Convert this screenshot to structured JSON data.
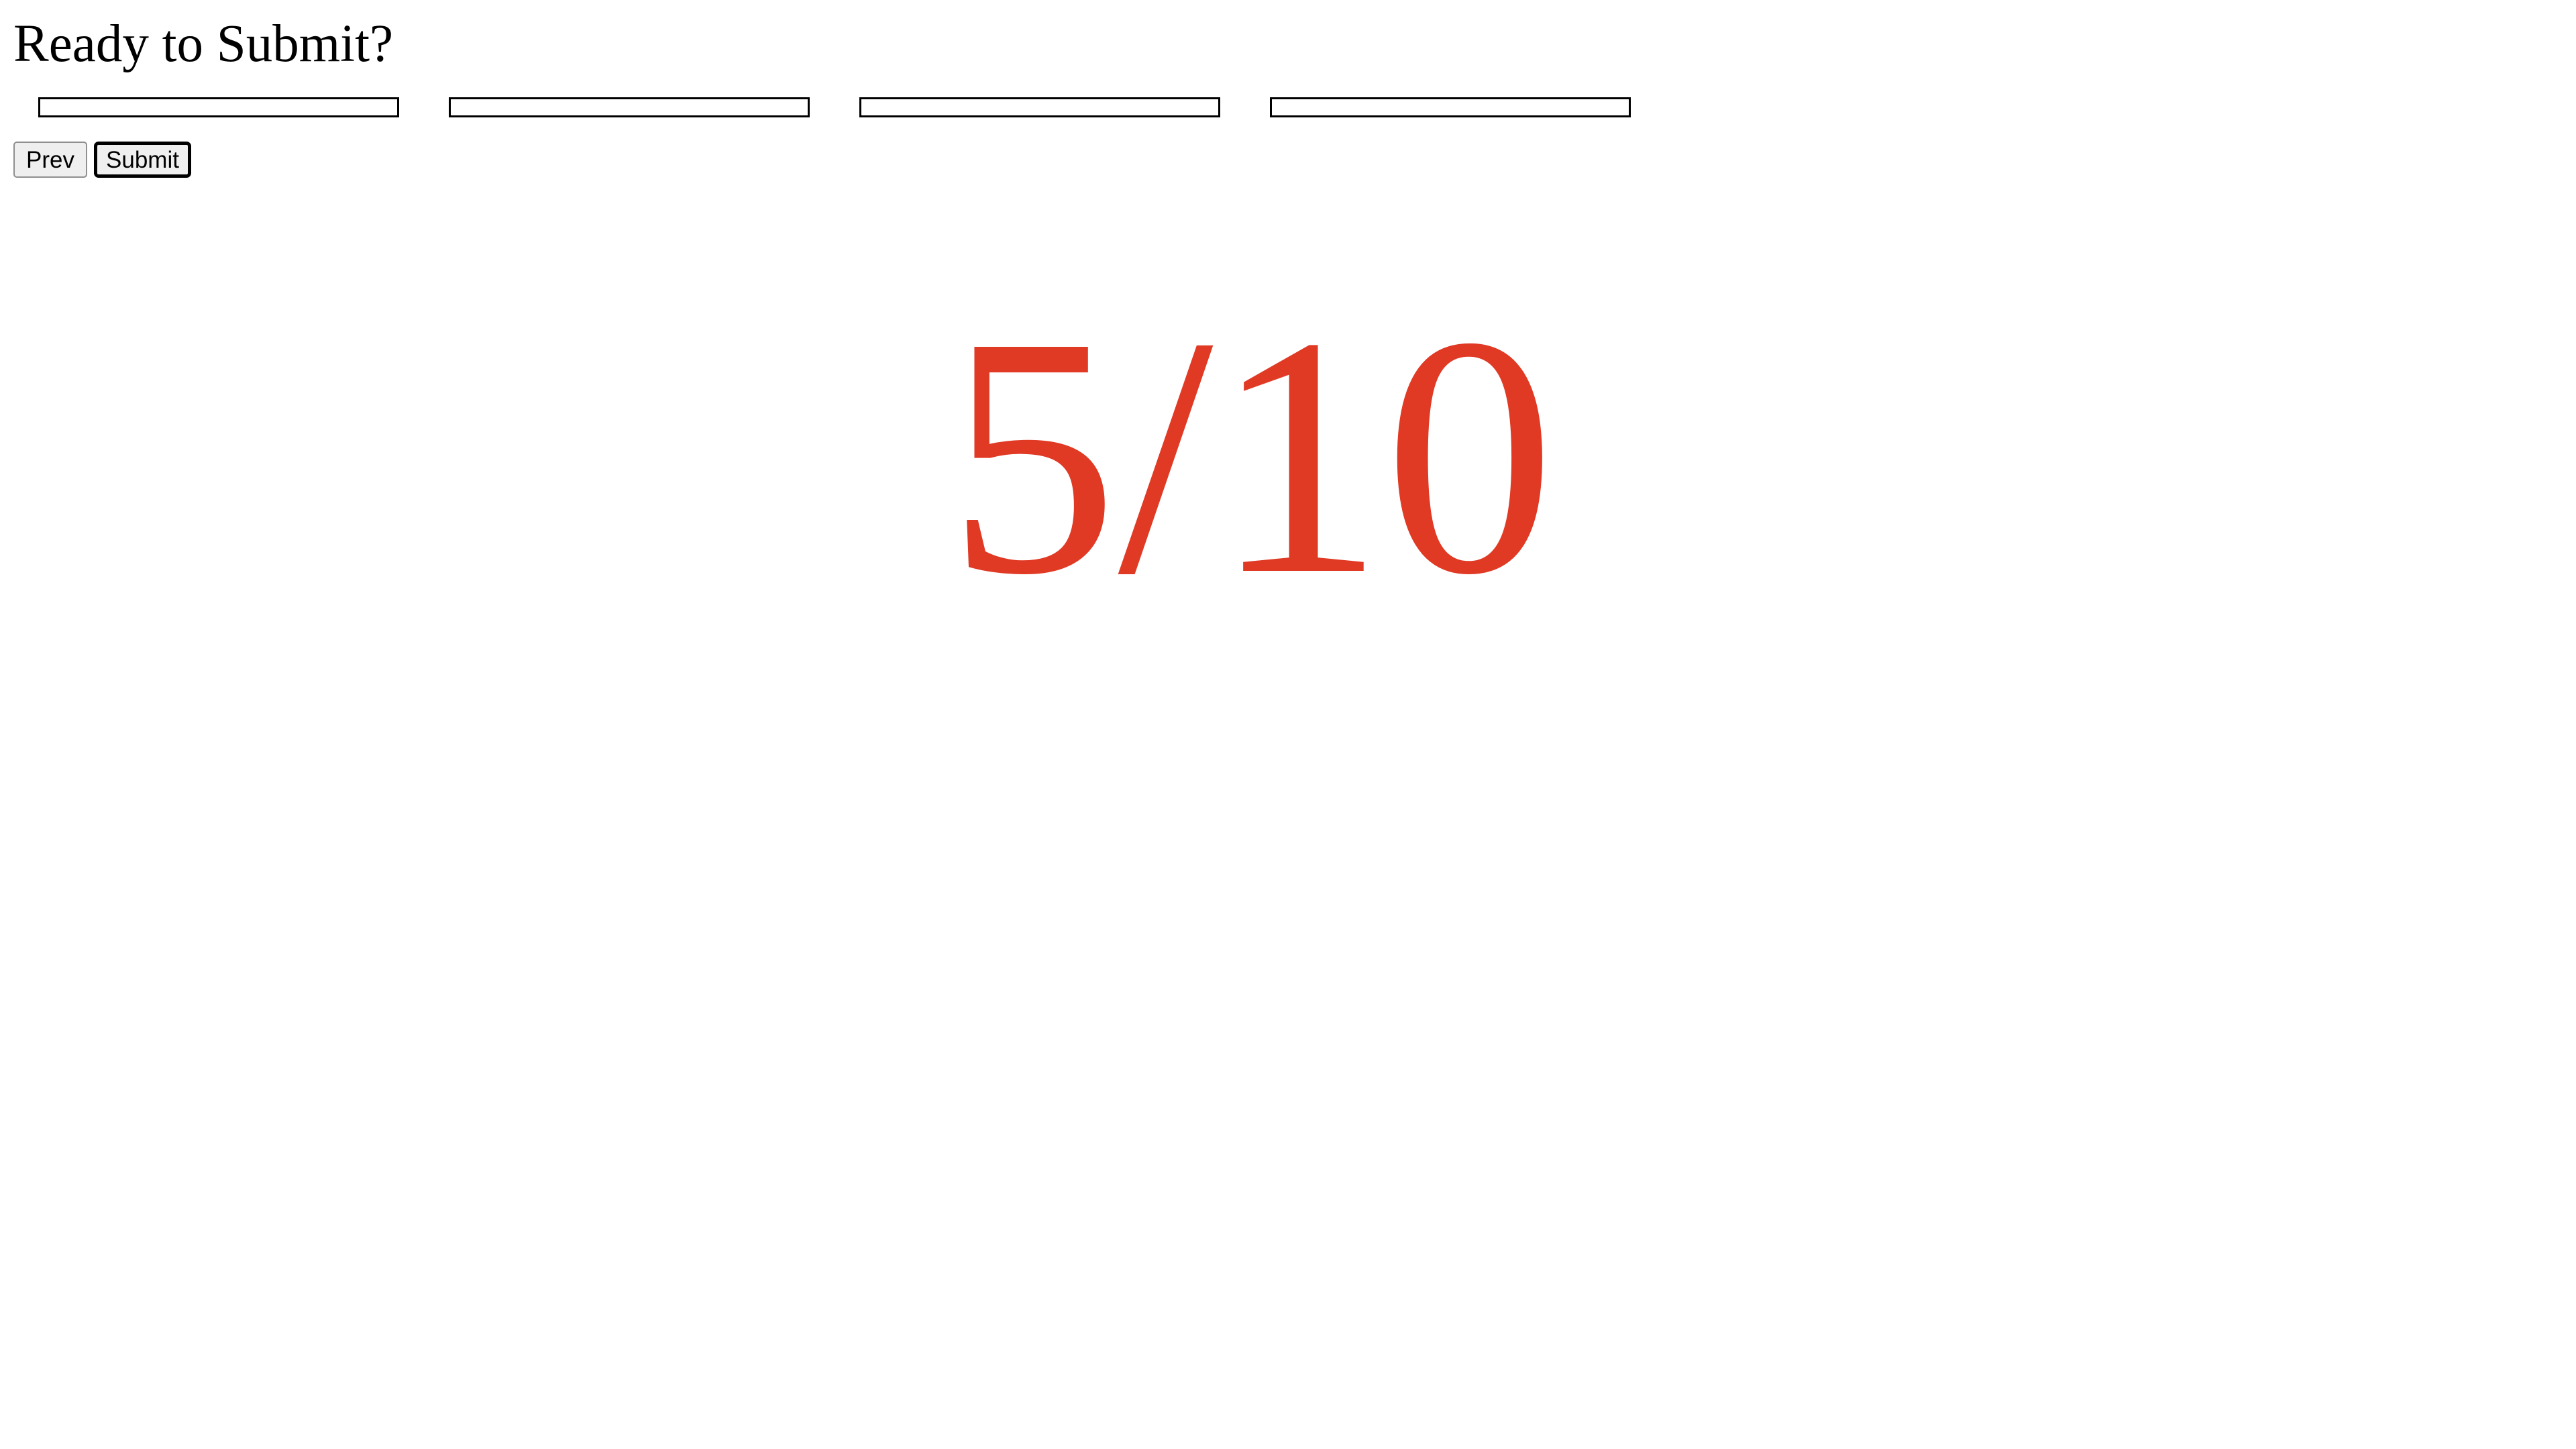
{
  "page": {
    "title": "Ready to Submit?"
  },
  "fields": [
    {
      "value": "",
      "placeholder": ""
    },
    {
      "value": "",
      "placeholder": ""
    },
    {
      "value": "",
      "placeholder": ""
    },
    {
      "value": "",
      "placeholder": ""
    }
  ],
  "navigation": {
    "prev_label": "Prev",
    "submit_label": "Submit"
  },
  "score": {
    "text": "5/10",
    "correct": 5,
    "total": 10,
    "color": "#e03a25"
  }
}
